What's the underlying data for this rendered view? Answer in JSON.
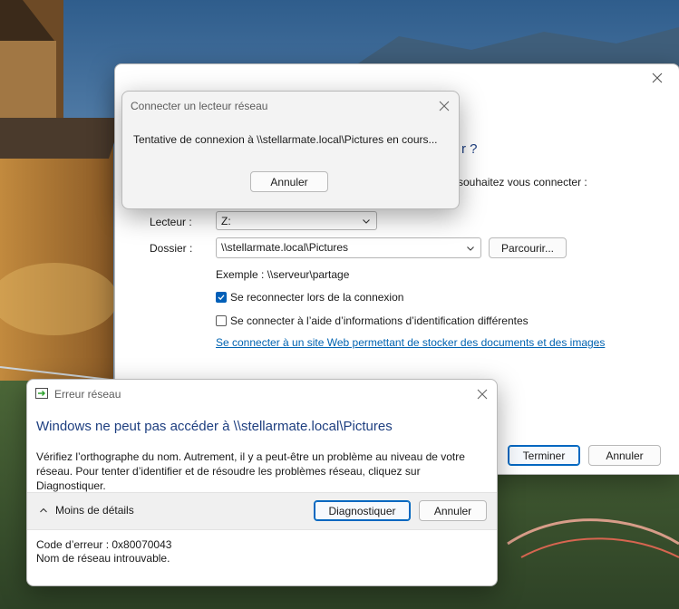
{
  "map_window": {
    "heading_fragment": "r ?",
    "question": "souhaitez vous connecter :",
    "drive_label": "Lecteur :",
    "drive_value": "Z:",
    "folder_label": "Dossier :",
    "folder_value": "\\\\stellarmate.local\\Pictures",
    "browse_button": "Parcourir...",
    "example": "Exemple : \\\\serveur\\partage",
    "reconnect_label": "Se reconnecter lors de la connexion",
    "reconnect_checked": true,
    "other_creds_label": "Se connecter à l’aide d’informations d’identification différentes",
    "other_creds_checked": false,
    "web_link": "Se connecter à un site Web permettant de stocker des documents et des images",
    "web_link_suffix": ".",
    "finish_button": "Terminer",
    "cancel_button": "Annuler"
  },
  "connecting_dialog": {
    "title": "Connecter un lecteur réseau",
    "message": "Tentative de connexion à \\\\stellarmate.local\\Pictures en cours...",
    "cancel_button": "Annuler"
  },
  "error_dialog": {
    "title": "Erreur réseau",
    "heading": "Windows ne peut pas accéder à \\\\stellarmate.local\\Pictures",
    "body": "Vérifiez l’orthographe du nom. Autrement, il y a peut-être un problème au niveau de votre réseau. Pour tenter d’identifier et de résoudre les problèmes réseau, cliquez sur Diagnostiquer.",
    "less_details": "Moins de détails",
    "diagnose_button": "Diagnostiquer",
    "cancel_button": "Annuler",
    "error_code": "Code d’erreur : 0x80070043",
    "error_message": "Nom de réseau introuvable."
  },
  "icons": {
    "close": "close-icon",
    "chevron_down": "chevron-down-icon",
    "chevron_up": "chevron-up-icon",
    "checkmark": "checkmark-icon",
    "network_error": "network-error-icon"
  },
  "colors": {
    "accent": "#005fb8",
    "heading_blue": "#1e3f80",
    "link": "#0063b1"
  }
}
